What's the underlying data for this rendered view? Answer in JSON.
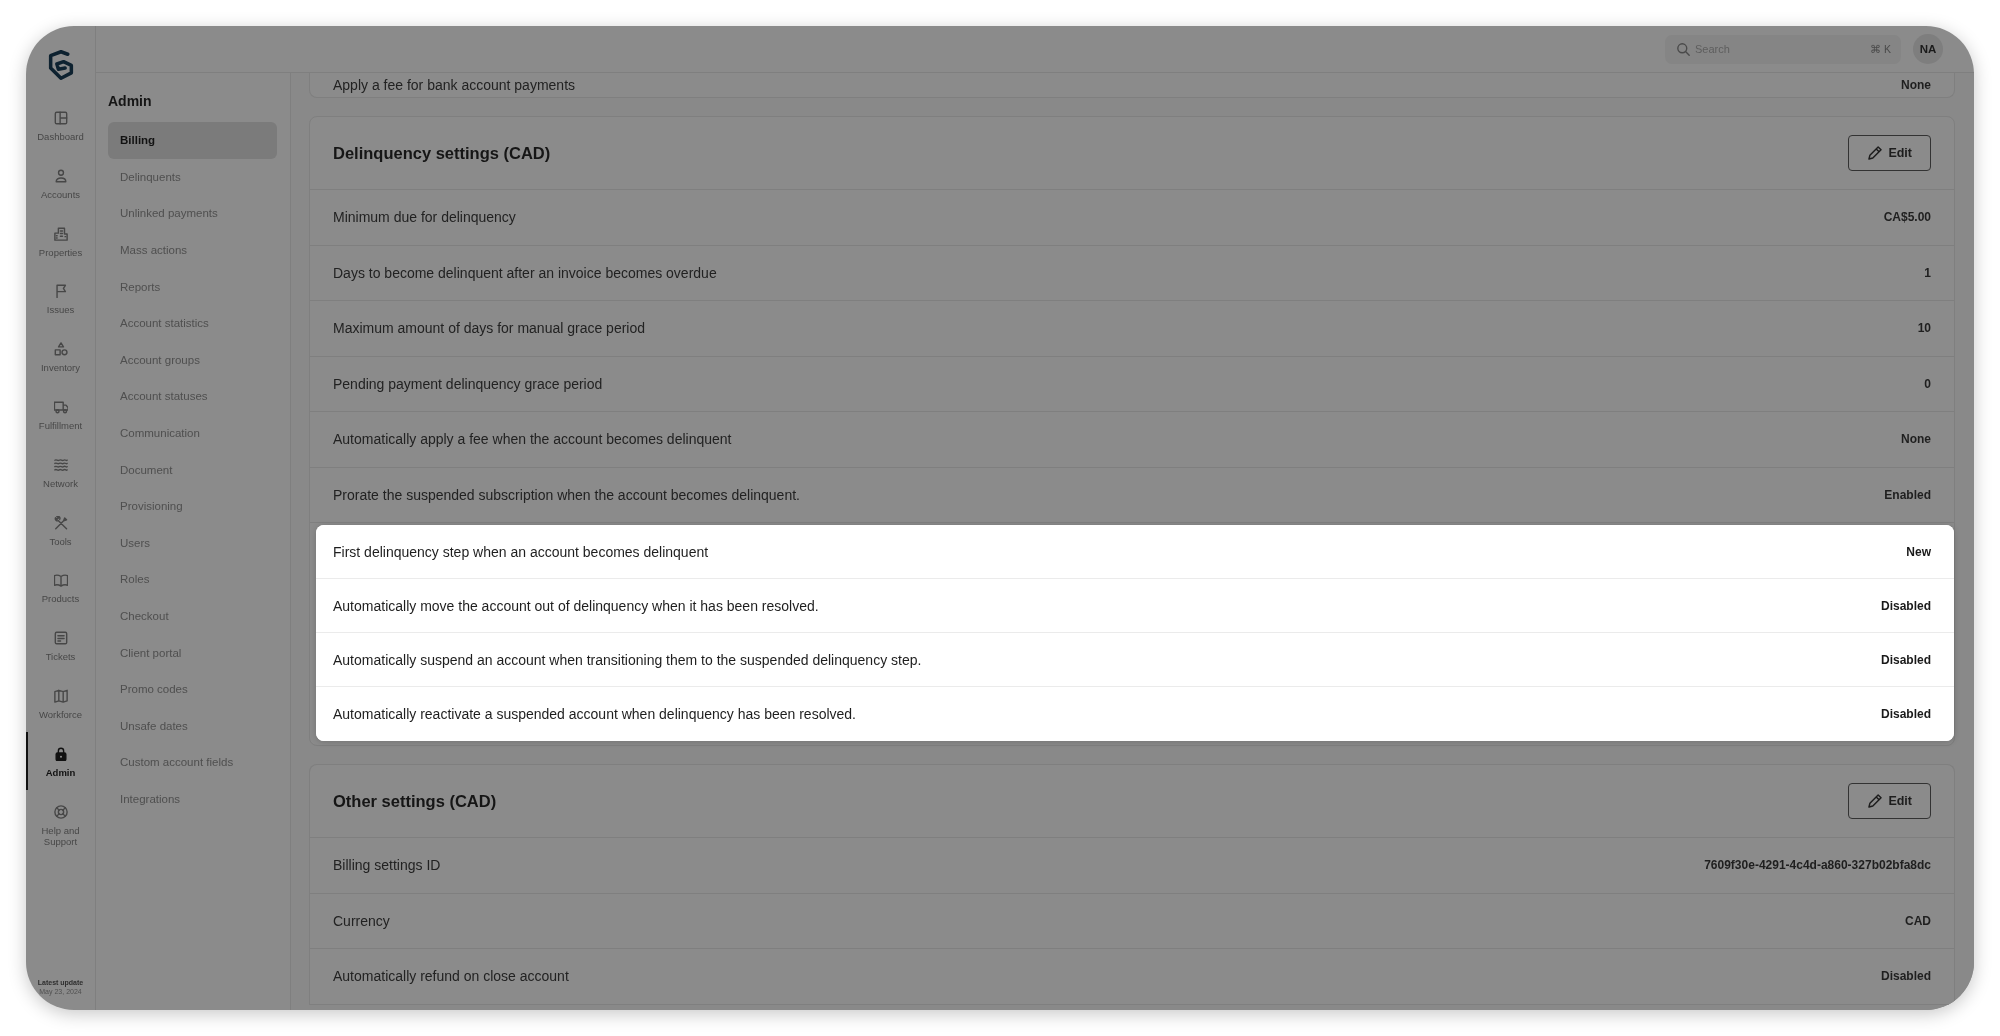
{
  "nav_rail": {
    "items": [
      {
        "label": "Dashboard",
        "selected": false
      },
      {
        "label": "Accounts",
        "selected": false
      },
      {
        "label": "Properties",
        "selected": false
      },
      {
        "label": "Issues",
        "selected": false
      },
      {
        "label": "Inventory",
        "selected": false
      },
      {
        "label": "Fulfillment",
        "selected": false
      },
      {
        "label": "Network",
        "selected": false
      },
      {
        "label": "Tools",
        "selected": false
      },
      {
        "label": "Products",
        "selected": false
      },
      {
        "label": "Tickets",
        "selected": false
      },
      {
        "label": "Workforce",
        "selected": false
      },
      {
        "label": "Admin",
        "selected": true
      },
      {
        "label": "Help and Support",
        "selected": false
      }
    ],
    "footer": {
      "title": "Latest update",
      "date": "May 23, 2024"
    }
  },
  "top_bar": {
    "search": {
      "placeholder": "Search",
      "shortcut": "⌘ K"
    },
    "avatar": "NA"
  },
  "submenu": {
    "title": "Admin",
    "items": [
      {
        "label": "Billing",
        "selected": true
      },
      {
        "label": "Delinquents",
        "selected": false
      },
      {
        "label": "Unlinked payments",
        "selected": false
      },
      {
        "label": "Mass actions",
        "selected": false
      },
      {
        "label": "Reports",
        "selected": false
      },
      {
        "label": "Account statistics",
        "selected": false
      },
      {
        "label": "Account groups",
        "selected": false
      },
      {
        "label": "Account statuses",
        "selected": false
      },
      {
        "label": "Communication",
        "selected": false
      },
      {
        "label": "Document",
        "selected": false
      },
      {
        "label": "Provisioning",
        "selected": false
      },
      {
        "label": "Users",
        "selected": false
      },
      {
        "label": "Roles",
        "selected": false
      },
      {
        "label": "Checkout",
        "selected": false
      },
      {
        "label": "Client portal",
        "selected": false
      },
      {
        "label": "Promo codes",
        "selected": false
      },
      {
        "label": "Unsafe dates",
        "selected": false
      },
      {
        "label": "Custom account fields",
        "selected": false
      },
      {
        "label": "Integrations",
        "selected": false
      }
    ]
  },
  "sections": [
    {
      "rows": [
        {
          "label": "Apply a fee for bank account payments",
          "value": "None",
          "highlighted": false
        }
      ]
    },
    {
      "title": "Delinquency settings (CAD)",
      "action": "Edit",
      "rows": [
        {
          "label": "Minimum due for delinquency",
          "value": "CA$5.00",
          "highlighted": false
        },
        {
          "label": "Days to become delinquent after an invoice becomes overdue",
          "value": "1",
          "highlighted": false
        },
        {
          "label": "Maximum amount of days for manual grace period",
          "value": "10",
          "highlighted": false
        },
        {
          "label": "Pending payment delinquency grace period",
          "value": "0",
          "highlighted": false
        },
        {
          "label": "Automatically apply a fee when the account becomes delinquent",
          "value": "None",
          "highlighted": false
        },
        {
          "label": "Prorate the suspended subscription when the account becomes delinquent.",
          "value": "Enabled",
          "highlighted": false
        },
        {
          "label": "First delinquency step when an account becomes delinquent",
          "value": "New",
          "highlighted": true
        },
        {
          "label": "Automatically move the account out of delinquency when it has been resolved.",
          "value": "Disabled",
          "highlighted": true
        },
        {
          "label": "Automatically suspend an account when transitioning them to the suspended delinquency step.",
          "value": "Disabled",
          "highlighted": true
        },
        {
          "label": "Automatically reactivate a suspended account when delinquency has been resolved.",
          "value": "Disabled",
          "highlighted": true
        }
      ]
    },
    {
      "title": "Other settings (CAD)",
      "action": "Edit",
      "rows": [
        {
          "label": "Billing settings ID",
          "value": "7609f30e-4291-4c4d-a860-327b02bfa8dc",
          "highlighted": false
        },
        {
          "label": "Currency",
          "value": "CAD",
          "highlighted": false
        },
        {
          "label": "Automatically refund on close account",
          "value": "Disabled",
          "highlighted": false
        }
      ]
    }
  ]
}
